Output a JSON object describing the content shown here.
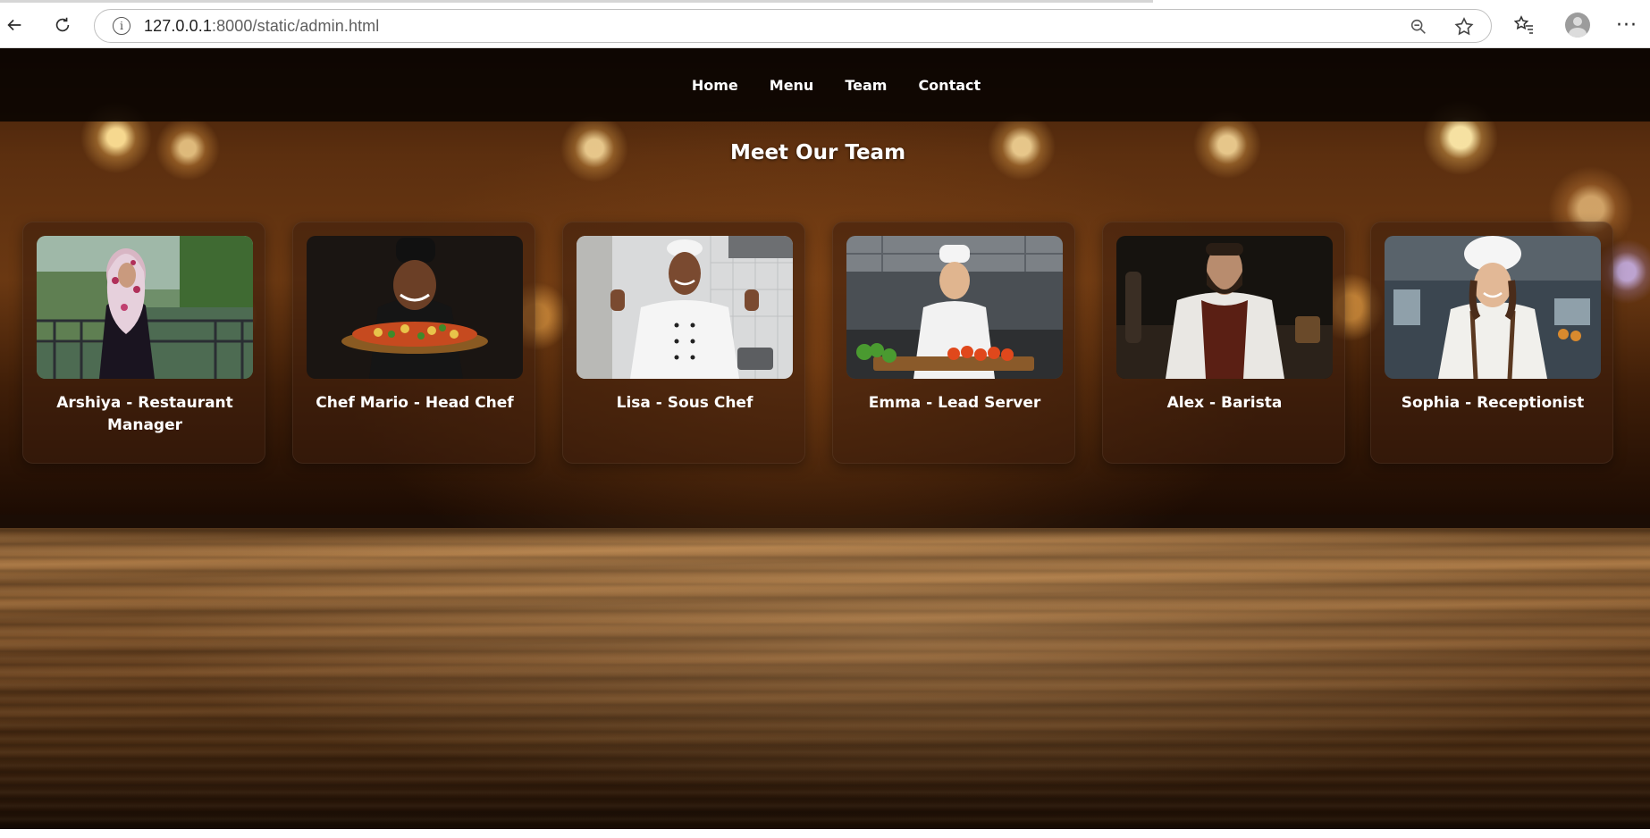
{
  "browser": {
    "url_host": "127.0.0.1",
    "url_path": ":8000/static/admin.html",
    "icons": [
      "back-arrow-icon",
      "reload-icon",
      "site-info-icon",
      "zoom-out-icon",
      "favorite-star-icon",
      "favorites-icon",
      "profile-icon",
      "more-icon"
    ]
  },
  "nav": {
    "items": [
      {
        "label": "Home"
      },
      {
        "label": "Menu"
      },
      {
        "label": "Team"
      },
      {
        "label": "Contact"
      }
    ]
  },
  "team": {
    "title": "Meet Our Team",
    "members": [
      {
        "caption": "Arshiya - Restaurant Manager"
      },
      {
        "caption": "Chef Mario - Head Chef"
      },
      {
        "caption": "Lisa - Sous Chef"
      },
      {
        "caption": "Emma - Lead Server"
      },
      {
        "caption": "Alex - Barista"
      },
      {
        "caption": "Sophia - Receptionist"
      }
    ]
  },
  "colors": {
    "navbar_bg": "#080301",
    "text": "#ffffff",
    "card_bg": "#3c1e0c"
  }
}
